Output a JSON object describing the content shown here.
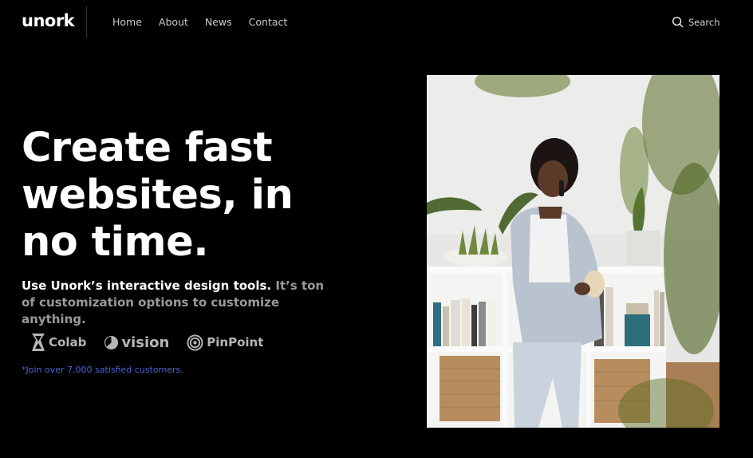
{
  "nav": {
    "logo": "unork",
    "links": [
      "Home",
      "About",
      "News",
      "Contact"
    ],
    "search_label": "Search"
  },
  "hero": {
    "headline_lines": [
      "Create fast",
      "websites, in",
      "no time."
    ],
    "subtext_strong": "Use Unork’s interactive design tools.",
    "subtext_muted": "It’s ton of customization options to customize anything.",
    "brands": [
      {
        "name": "Colab",
        "icon": "colab-logo-icon"
      },
      {
        "name": "vision",
        "icon": "vision-logo-icon"
      },
      {
        "name": "PinPoint",
        "icon": "pinpoint-logo-icon"
      }
    ],
    "join_note": "*Join over 7,000 satisfied customers."
  },
  "colors": {
    "background": "#000000",
    "text": "#ffffff",
    "muted_text": "#9a9a9a",
    "accent_link": "#4a62d8"
  }
}
